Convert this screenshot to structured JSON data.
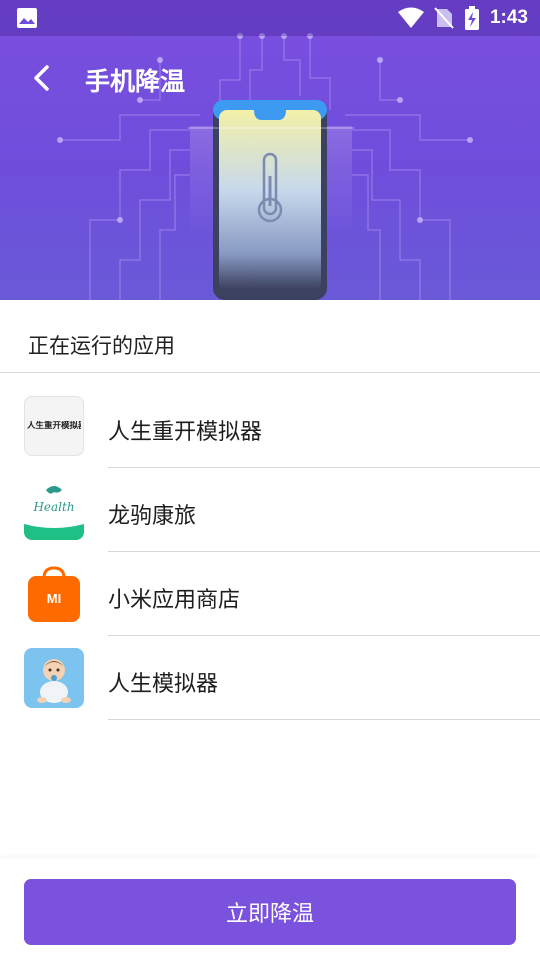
{
  "status_bar": {
    "time": "1:43",
    "icons": [
      "image-icon",
      "wifi-icon",
      "no-sim-icon",
      "battery-charging-icon"
    ]
  },
  "header": {
    "back_icon": "back-arrow-icon",
    "title": "手机降温"
  },
  "section": {
    "title": "正在运行的应用"
  },
  "apps": [
    {
      "name": "人生重开模拟器",
      "icon": "life-restart-app-icon"
    },
    {
      "name": "龙驹康旅",
      "icon": "longju-health-app-icon"
    },
    {
      "name": "小米应用商店",
      "icon": "mi-store-app-icon"
    },
    {
      "name": "人生模拟器",
      "icon": "life-simulator-app-icon"
    }
  ],
  "icon_text": {
    "app0": "人生重开模拟器",
    "app1": "Health",
    "app2": "MI"
  },
  "action": {
    "button_label": "立即降温"
  },
  "colors": {
    "primary": "#7b52de",
    "header_gradient_top": "#7b4fe0",
    "text": "#222222",
    "divider": "#d8d8d8"
  }
}
